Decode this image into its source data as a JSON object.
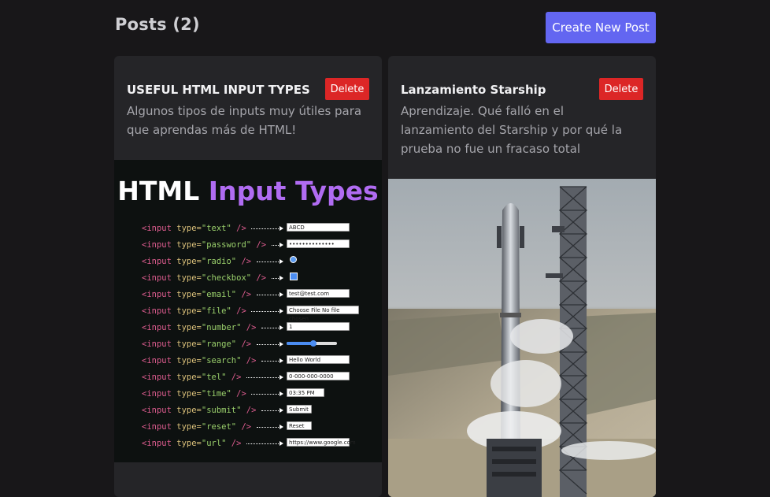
{
  "header": {
    "title": "Posts (2)",
    "create_button": "Create New Post"
  },
  "posts": [
    {
      "title": "USEFUL HTML INPUT TYPES",
      "delete_label": "Delete",
      "description": "Algunos tipos de inputs muy útiles para que aprendas más de HTML!",
      "image": {
        "heading_white": "HTML",
        "heading_purple": "Input Types",
        "rows": [
          {
            "type": "\"text\"",
            "demo": "ABCD"
          },
          {
            "type": "\"password\"",
            "demo": "••••••••••••••"
          },
          {
            "type": "\"radio\"",
            "demo": ""
          },
          {
            "type": "\"checkbox\"",
            "demo": ""
          },
          {
            "type": "\"email\"",
            "demo": "test@test.com"
          },
          {
            "type": "\"file\"",
            "demo": "Choose File  No file chosen"
          },
          {
            "type": "\"number\"",
            "demo": "1"
          },
          {
            "type": "\"range\"",
            "demo": ""
          },
          {
            "type": "\"search\"",
            "demo": "Hello World"
          },
          {
            "type": "\"tel\"",
            "demo": "0-000-000-0000"
          },
          {
            "type": "\"time\"",
            "demo": "03:35 PM"
          },
          {
            "type": "\"submit\"",
            "demo": "Submit"
          },
          {
            "type": "\"reset\"",
            "demo": "Reset"
          },
          {
            "type": "\"url\"",
            "demo": "https://www.google.com"
          }
        ]
      }
    },
    {
      "title": "Lanzamiento Starship",
      "delete_label": "Delete",
      "description": "Aprendizaje. Qué falló en el lanzamiento del Starship y por qué la prueba no fue un fracaso total"
    }
  ],
  "colors": {
    "background": "#181719",
    "card": "#252528",
    "accent": "#6366f1",
    "danger": "#dc2626"
  }
}
